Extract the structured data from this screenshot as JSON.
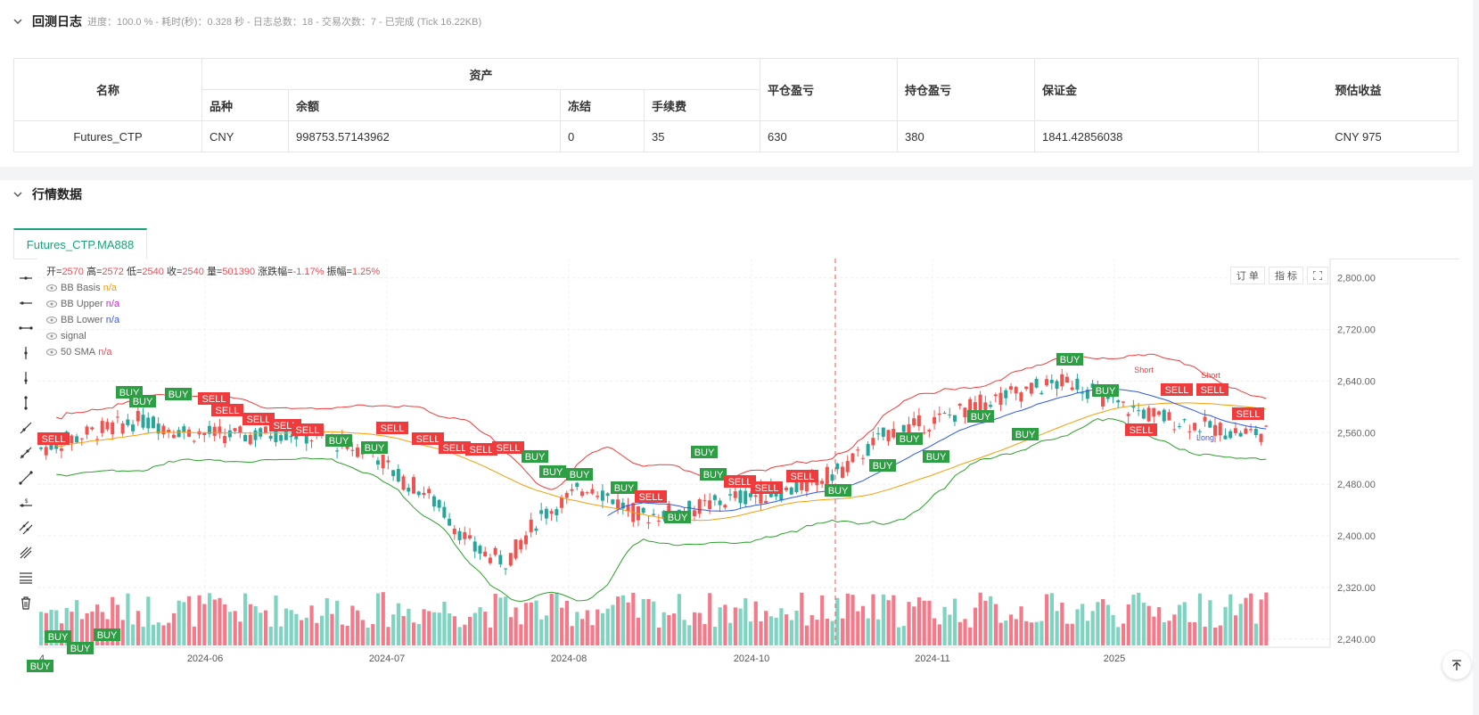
{
  "log": {
    "title": "回测日志",
    "summary": "进度：100.0 % - 耗时(秒)：0.328  秒 - 日志总数：18 - 交易次数：7 - 已完成 (Tick 16.22KB)"
  },
  "assets_table": {
    "headers": {
      "name": "名称",
      "assets": "资产",
      "symbol": "品种",
      "balance": "余额",
      "frozen": "冻结",
      "fee": "手续费",
      "close_pnl": "平仓盈亏",
      "position_pnl": "持仓盈亏",
      "margin": "保证金",
      "est_profit": "预估收益"
    },
    "row": {
      "name": "Futures_CTP",
      "symbol": "CNY",
      "balance": "998753.57143962",
      "frozen": "0",
      "fee": "35",
      "close_pnl": "630",
      "position_pnl": "380",
      "margin": "1841.42856038",
      "est_profit": "CNY 975"
    }
  },
  "market": {
    "title": "行情数据",
    "tab": "Futures_CTP.MA888"
  },
  "ohlc": {
    "open_label": "开=",
    "open": "2570",
    "high_label": "高=",
    "high": "2572",
    "low_label": "低=",
    "low": "2540",
    "close_label": "收=",
    "close": "2540",
    "vol_label": "量=",
    "vol": "501390",
    "chg_label": "涨跌幅=",
    "chg": "-1.17%",
    "amp_label": "振幅=",
    "amp": "1.25%"
  },
  "indicators": [
    {
      "name": "BB Basis",
      "value": "n/a",
      "color": "#f39c12"
    },
    {
      "name": "BB Upper",
      "value": "n/a",
      "color": "#c026d3"
    },
    {
      "name": "BB Lower",
      "value": "n/a",
      "color": "#3a56e8"
    },
    {
      "name": "signal",
      "value": "",
      "color": "#999999"
    },
    {
      "name": "50 SMA",
      "value": "n/a",
      "color": "#e8505b"
    }
  ],
  "controls": {
    "order": "订 单",
    "indicator": "指 标"
  },
  "chart_data": {
    "type": "candlestick",
    "y_ticks": [
      "2,800.00",
      "2,720.00",
      "2,640.00",
      "2,560.00",
      "2,480.00",
      "2,400.00",
      "2,320.00",
      "2,240.00"
    ],
    "x_ticks": [
      "4",
      "2024-06",
      "2024-07",
      "2024-08",
      "2024-10",
      "2024-11",
      "2025"
    ],
    "ylim": [
      2230,
      2830
    ],
    "signal_labels": {
      "buy": "BUY",
      "sell": "SELL",
      "long": "Long",
      "short": "Short"
    },
    "colors": {
      "up": "#26a69a",
      "down": "#ef5350",
      "upper": "#ef3b3b",
      "lower": "#2ca02c",
      "basis": "#f59e0b",
      "sma": "#2b59e8"
    }
  }
}
